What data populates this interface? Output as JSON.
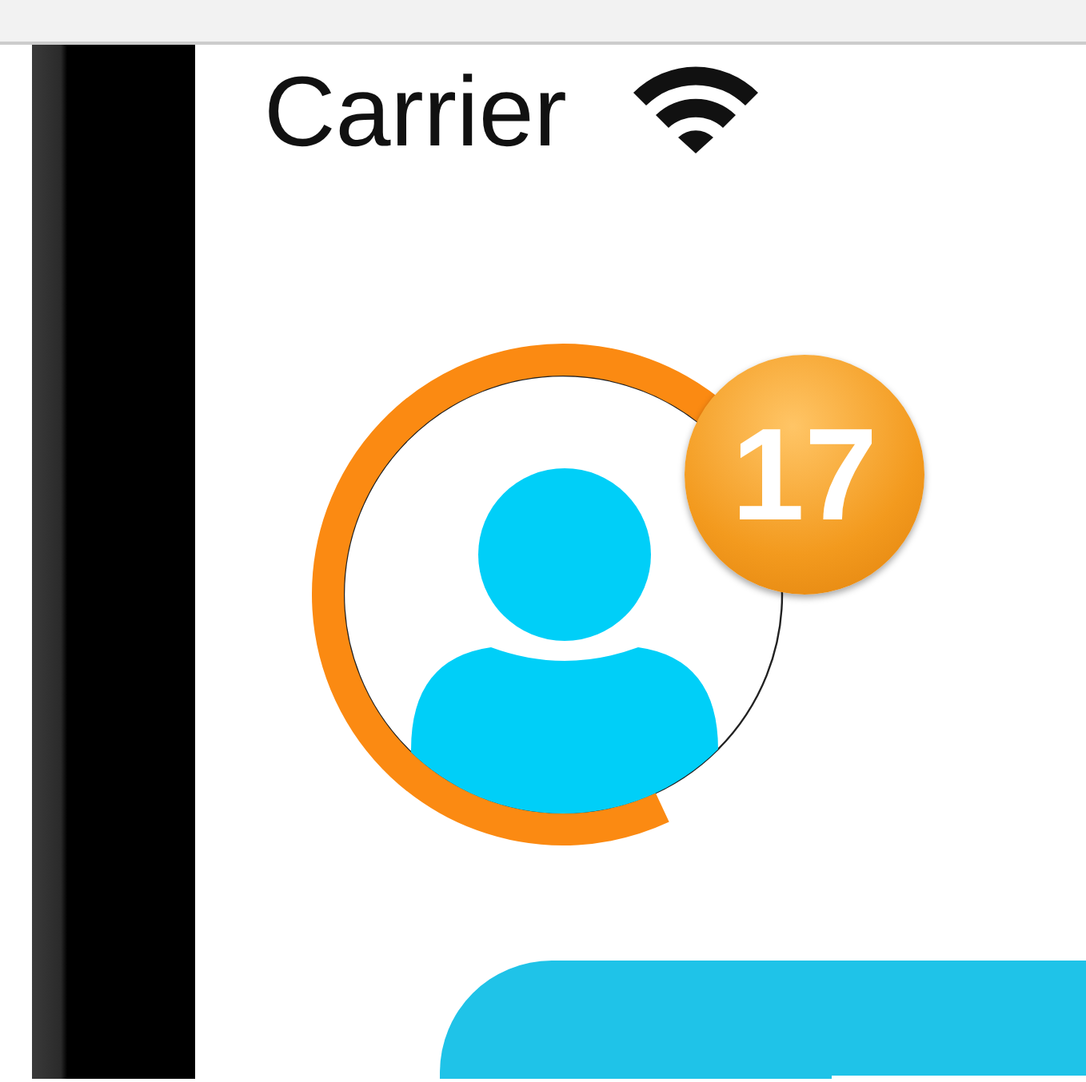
{
  "status_bar": {
    "carrier": "Carrier"
  },
  "avatar": {
    "progress": {
      "level": 0.7
    },
    "badge": "17"
  },
  "action_button": {
    "kind": "button"
  }
}
